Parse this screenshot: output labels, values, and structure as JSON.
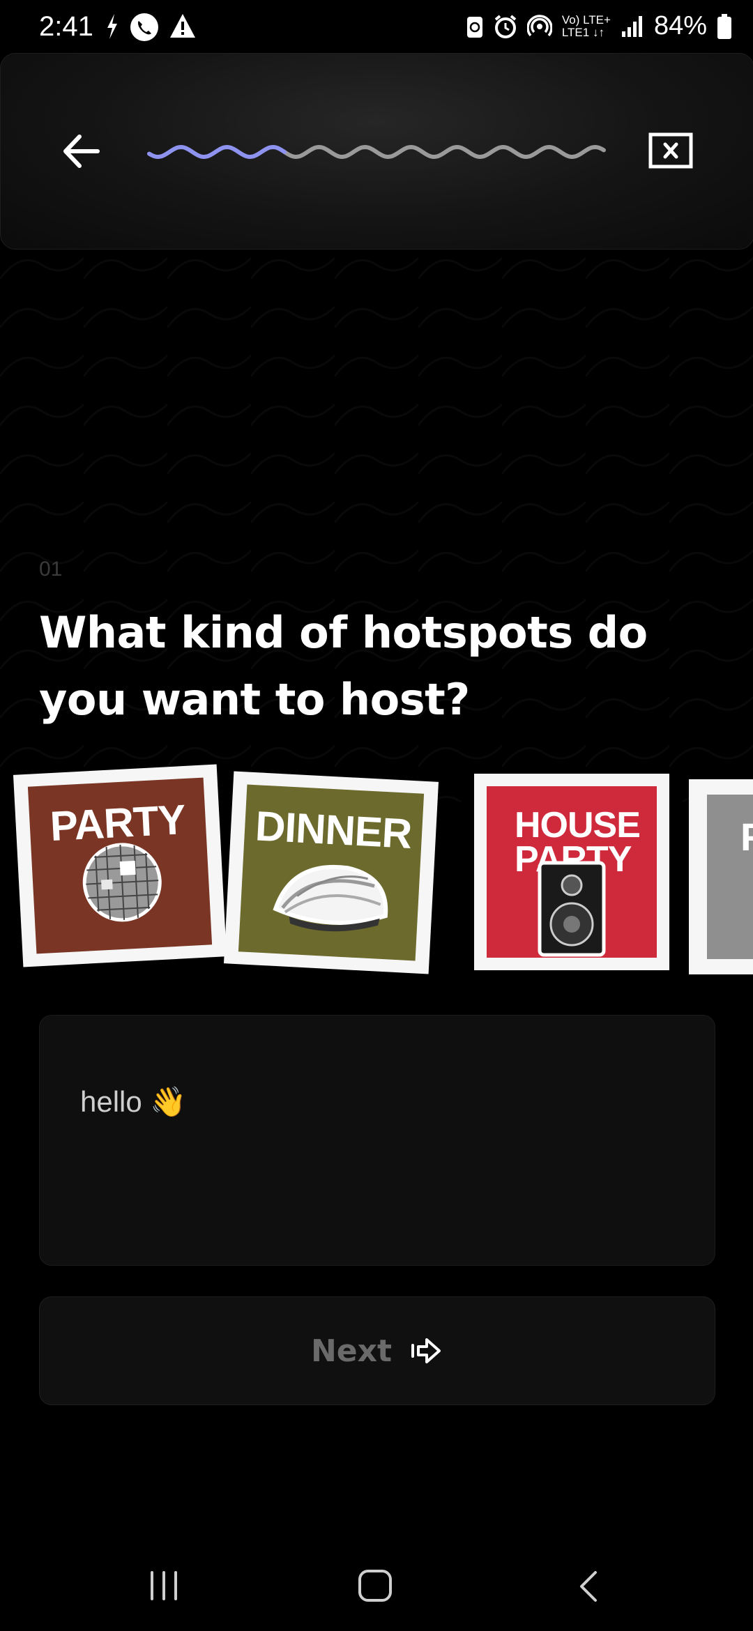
{
  "status_bar": {
    "time": "2:41",
    "network": "Vo) LTE+\nLTE1",
    "battery": "84%"
  },
  "header": {
    "back_icon": "arrow-left-icon",
    "close_icon": "close-box-icon",
    "progress": 0.3,
    "progress_color": "#8f93f0",
    "track_color": "#9a9a9a"
  },
  "question": {
    "number": "01",
    "title": "What kind of hotspots do you want to host?"
  },
  "categories": [
    {
      "label": "PARTY",
      "bg": "#7a3524",
      "icon": "disco-ball"
    },
    {
      "label": "DINNER",
      "bg": "#6c6a2c",
      "icon": "sushi"
    },
    {
      "label": "HOUSE PARTY",
      "bg": "#cf2a3c",
      "icon": "speaker"
    },
    {
      "label": "F",
      "bg": "#8f8f8f",
      "icon": "unknown"
    }
  ],
  "message": {
    "text": "hello 👋"
  },
  "next_button": {
    "label": "Next",
    "icon": "arrow-right-icon"
  },
  "nav": {
    "recents_icon": "recents-icon",
    "home_icon": "home-icon",
    "back_icon": "back-icon"
  }
}
